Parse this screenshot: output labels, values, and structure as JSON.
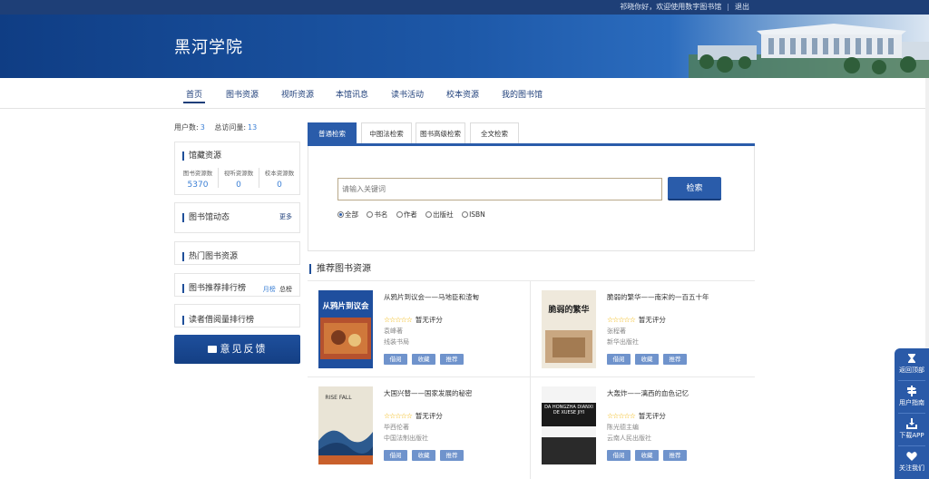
{
  "topbar": {
    "greeting": "祁晓你好，欢迎使用数字图书馆",
    "logout": "退出"
  },
  "site": {
    "title": "黑河学院"
  },
  "nav": [
    {
      "label": "首页",
      "active": true
    },
    {
      "label": "图书资源"
    },
    {
      "label": "视听资源"
    },
    {
      "label": "本馆讯息"
    },
    {
      "label": "读书活动"
    },
    {
      "label": "校本资源"
    },
    {
      "label": "我的图书馆"
    }
  ],
  "stats": {
    "users_label": "用户数:",
    "users": "3",
    "visits_label": "总访问量:",
    "visits": "13"
  },
  "holdings": {
    "title": "馆藏资源",
    "cols": [
      {
        "label": "图书资源数",
        "value": "5370"
      },
      {
        "label": "视听资源数",
        "value": "0"
      },
      {
        "label": "校本资源数",
        "value": "0"
      }
    ]
  },
  "news": {
    "title": "图书馆动态",
    "more": "更多"
  },
  "hot": {
    "title": "热门图书资源"
  },
  "rank": {
    "title": "图书推荐排行榜",
    "monthly": "月榜",
    "total": "总榜"
  },
  "borrow": {
    "title": "读者借阅量排行榜"
  },
  "feedback": {
    "label": "意见反馈"
  },
  "search": {
    "tabs": [
      "普通检索",
      "中图法检索",
      "图书高级检索",
      "全文检索"
    ],
    "placeholder": "请输入关键词",
    "button": "检索",
    "options": [
      "全部",
      "书名",
      "作者",
      "出版社",
      "ISBN"
    ]
  },
  "recommend": {
    "title": "推荐图书资源",
    "no_rating": "暂无评分",
    "btn_borrow": "借阅",
    "btn_collect": "收藏",
    "btn_recommend": "推荐",
    "books": [
      {
        "title": "从鸦片到议会——马地臣和渣甸",
        "author": "袁峰著",
        "publisher": "线装书局",
        "cover_text": "从鸦片到议会"
      },
      {
        "title": "脆弱的繁华——南宋的一百五十年",
        "author": "张程著",
        "publisher": "新华出版社",
        "cover_text": "脆弱的繁华"
      },
      {
        "title": "大国兴替——国家发展的秘密",
        "author": "毕西伦著",
        "publisher": "中国法制出版社",
        "cover_text": "RISE FALL"
      },
      {
        "title": "大轰炸——漓西的血色记忆",
        "author": "陈光德主编",
        "publisher": "云南人民出版社",
        "cover_text": "DA HONGZHA DIANXI DE XUESE JIYI"
      }
    ]
  },
  "sidefloat": [
    "返回顶部",
    "用户指南",
    "下载APP",
    "关注我们"
  ],
  "colors": {
    "primary": "#2a5caa",
    "nav": "#1f3f7a",
    "accent": "#3a7fd5",
    "star": "#f1b400"
  }
}
